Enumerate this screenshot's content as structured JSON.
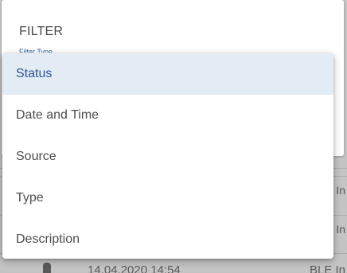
{
  "filter": {
    "title": "FILTER",
    "field_label": "Filter Type"
  },
  "menu": {
    "selected_index": 0,
    "items": [
      {
        "label": "Status"
      },
      {
        "label": "Date and Time"
      },
      {
        "label": "Source"
      },
      {
        "label": "Type"
      },
      {
        "label": "Description"
      }
    ]
  },
  "background_list": {
    "row_cells": [
      "In",
      "In"
    ],
    "last_row": {
      "time": "14.04.2020 14:54",
      "source": "BLE In"
    }
  },
  "colors": {
    "selected_bg": "#e3ebf5",
    "selected_text": "#2c5596",
    "overlay": "#c4c4c4"
  }
}
